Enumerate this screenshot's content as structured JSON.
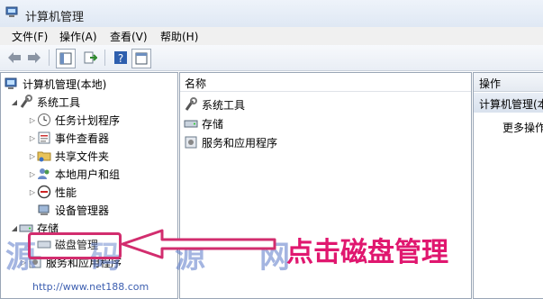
{
  "window": {
    "title": "计算机管理"
  },
  "menu": [
    "文件(F)",
    "操作(A)",
    "查看(V)",
    "帮助(H)"
  ],
  "toolbar": {
    "buttons": [
      "back-arrow-icon",
      "forward-arrow-icon",
      "console-tree-icon",
      "export-icon",
      "help-icon",
      "properties-icon"
    ]
  },
  "tree": {
    "root": "计算机管理(本地)",
    "system_tools": "系统工具",
    "task_scheduler": "任务计划程序",
    "event_viewer": "事件查看器",
    "shared_folders": "共享文件夹",
    "local_users": "本地用户和组",
    "performance": "性能",
    "device_manager": "设备管理器",
    "storage": "存储",
    "disk_management": "磁盘管理",
    "services_apps": "服务和应用程序"
  },
  "center": {
    "column_header": "名称",
    "items": [
      "系统工具",
      "存储",
      "服务和应用程序"
    ]
  },
  "actions": {
    "header": "操作",
    "selected": "计算机管理(本",
    "more": "更多操作"
  },
  "annotation": {
    "text": "点击磁盘管理",
    "color": "#e0176f"
  },
  "watermark": {
    "text": "源码源网",
    "url": "http://www.net188.com"
  }
}
